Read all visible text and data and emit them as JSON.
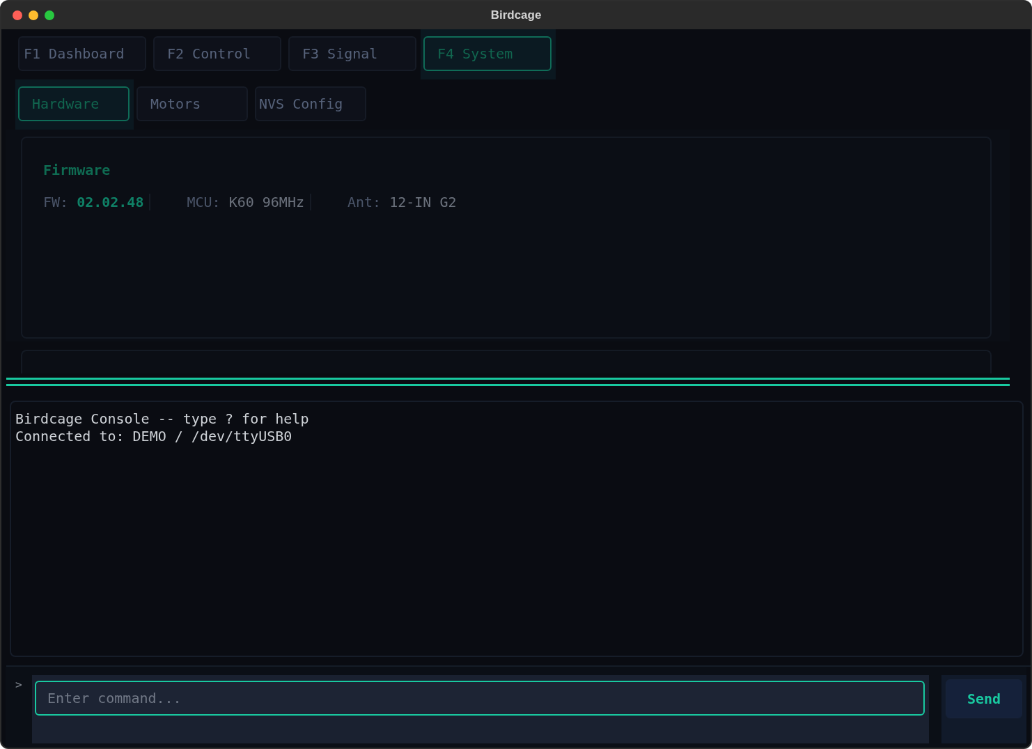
{
  "window": {
    "title": "Birdcage"
  },
  "tabs": [
    {
      "label": "F1 Dashboard",
      "selected": false
    },
    {
      "label": "F2 Control",
      "selected": false
    },
    {
      "label": "F3 Signal",
      "selected": false
    },
    {
      "label": "F4 System",
      "selected": true
    }
  ],
  "subtabs": [
    {
      "label": "Hardware",
      "selected": true
    },
    {
      "label": "Motors",
      "selected": false
    },
    {
      "label": "NVS Config",
      "selected": false
    }
  ],
  "firmware_panel": {
    "title": "Firmware",
    "fields": [
      {
        "label": "FW:",
        "value": "02.02.48",
        "accent": true
      },
      {
        "label": "MCU:",
        "value": "K60 96MHz",
        "accent": false
      },
      {
        "label": "Ant:",
        "value": "12-IN G2",
        "accent": false
      }
    ]
  },
  "console": {
    "lines": [
      "Birdcage Console -- type ? for help",
      "Connected to: DEMO / /dev/ttyUSB0"
    ]
  },
  "command": {
    "prompt": ">",
    "placeholder": "Enter command...",
    "send": "Send"
  }
}
